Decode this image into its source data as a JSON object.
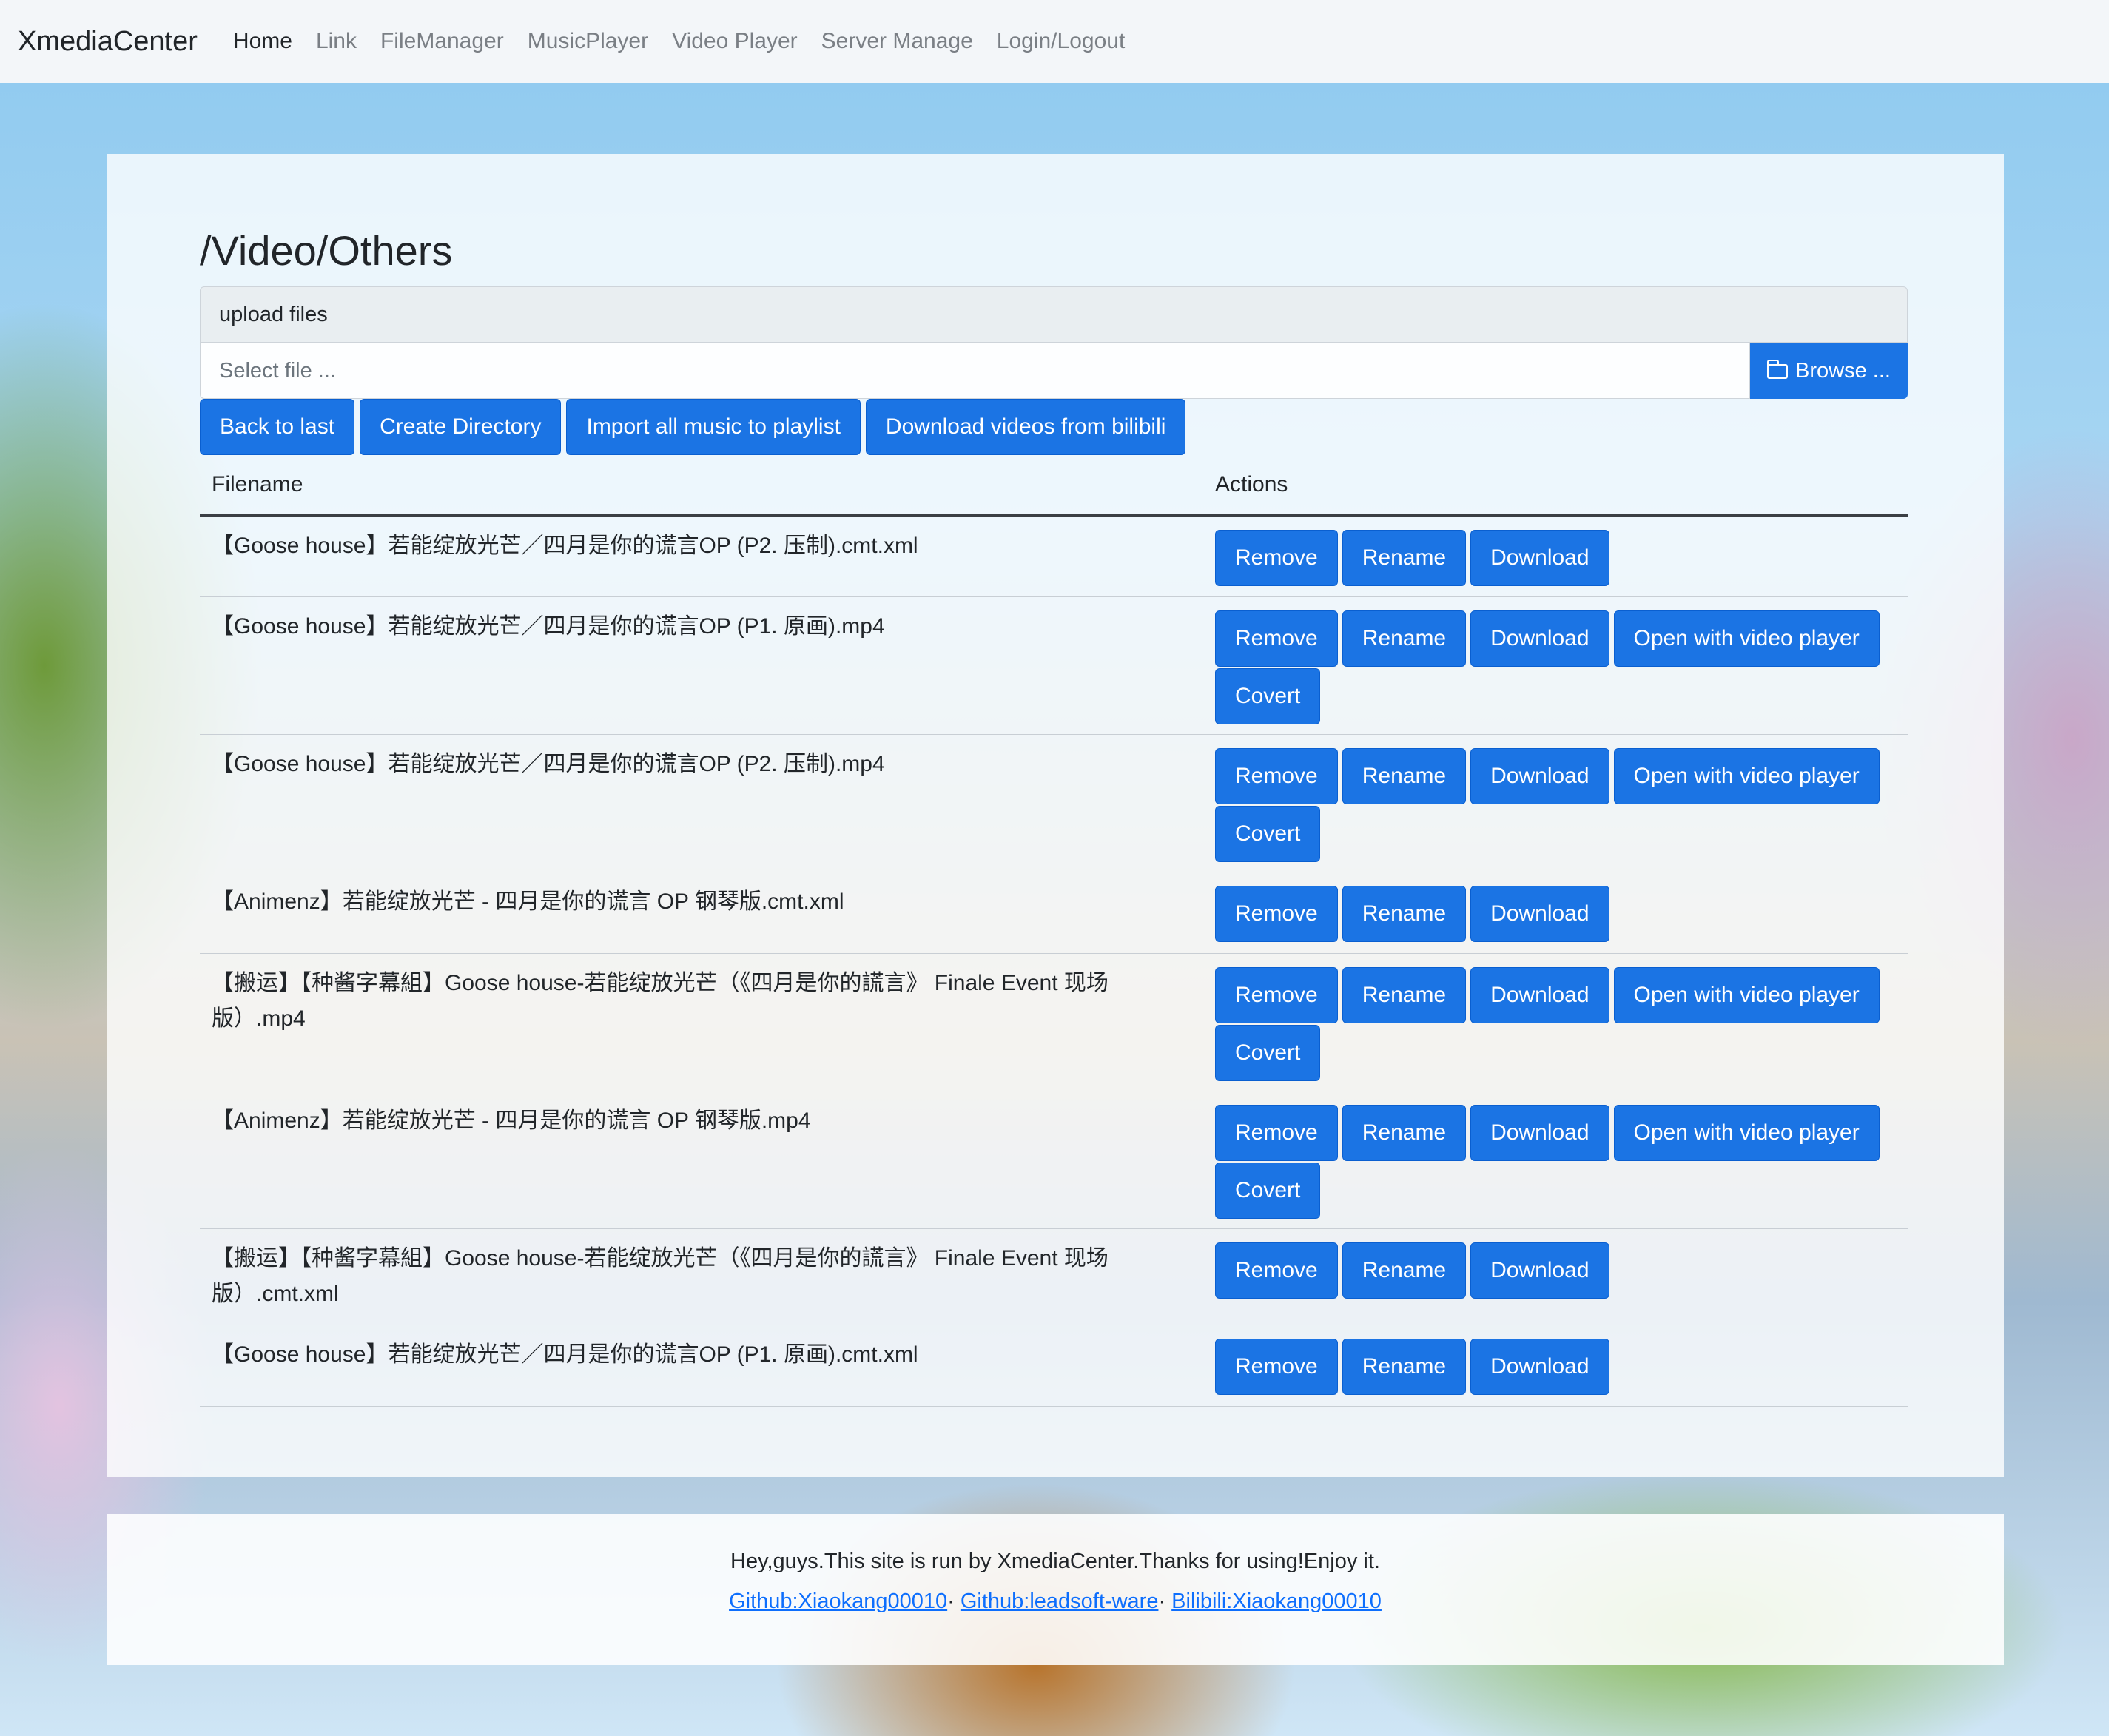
{
  "navbar": {
    "brand": "XmediaCenter",
    "links": [
      "Home",
      "Link",
      "FileManager",
      "MusicPlayer",
      "Video Player",
      "Server Manage",
      "Login/Logout"
    ]
  },
  "page": {
    "path": "/Video/Others",
    "upload_label": "upload files",
    "file_placeholder": "Select file ...",
    "browse_label": "Browse ..."
  },
  "toolbar": {
    "back": "Back to last",
    "create_dir": "Create Directory",
    "import_music": "Import all music to playlist",
    "download_bilibili": "Download videos from bilibili"
  },
  "table": {
    "headers": [
      "Filename",
      "Actions"
    ],
    "actions": {
      "remove": "Remove",
      "rename": "Rename",
      "download": "Download",
      "open_video": "Open with video player",
      "covert": "Covert"
    },
    "rows": [
      {
        "name": "【Goose house】若能绽放光芒／四月是你的谎言OP (P2. 压制).cmt.xml"
      },
      {
        "name": "【Goose house】若能绽放光芒／四月是你的谎言OP (P1. 原画).mp4"
      },
      {
        "name": "【Goose house】若能绽放光芒／四月是你的谎言OP (P2. 压制).mp4"
      },
      {
        "name": "【Animenz】若能绽放光芒 - 四月是你的谎言 OP 钢琴版.cmt.xml"
      },
      {
        "name": "【搬运】【种酱字幕組】Goose house-若能绽放光芒（《四月是你的謊言》 Finale Event 现场版）.mp4"
      },
      {
        "name": "【Animenz】若能绽放光芒 - 四月是你的谎言 OP 钢琴版.mp4"
      },
      {
        "name": "【搬运】【种酱字幕組】Goose house-若能绽放光芒（《四月是你的謊言》 Finale Event 现场版）.cmt.xml"
      },
      {
        "name": "【Goose house】若能绽放光芒／四月是你的谎言OP (P1. 原画).cmt.xml"
      }
    ]
  },
  "footer": {
    "text": "Hey,guys.This site is run by XmediaCenter.Thanks for using!Enjoy it.",
    "link1": "Github:Xiaokang00010",
    "link2": "Github:leadsoft-ware",
    "link3": "Bilibili:Xiaokang00010",
    "sep": "· "
  },
  "colors": {
    "primary": "#1b74e4",
    "link": "#0d6efd"
  }
}
